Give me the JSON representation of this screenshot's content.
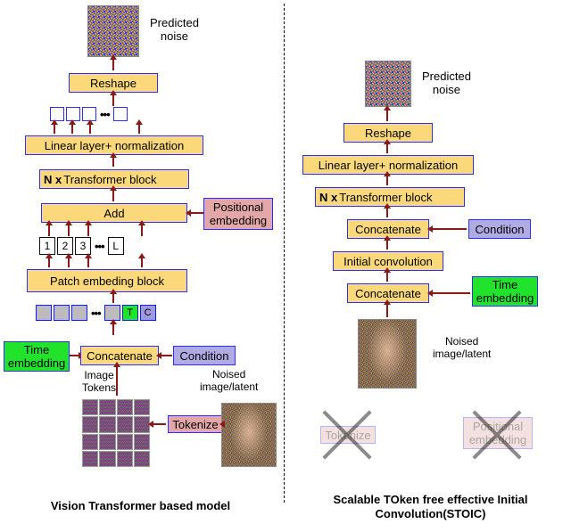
{
  "left": {
    "predicted_noise": "Predicted\nnoise",
    "reshape": "Reshape",
    "linear": "Linear layer+ normalization",
    "transformer_n": "N x ",
    "transformer": "Transformer block",
    "add": "Add",
    "pos_embed": "Positional\nembedding",
    "patch_embed": "Patch embeding block",
    "concatenate": "Concatenate",
    "time_embed": "Time\nembedding",
    "condition": "Condition",
    "image_tokens": "Image\nTokens",
    "tokenize": "Tokenize",
    "noised": "Noised\nimage/latent",
    "caption": "Vision Transformer based model",
    "num1": "1",
    "num2": "2",
    "num3": "3",
    "numL": "L",
    "tokT": "T",
    "tokC": "C"
  },
  "right": {
    "predicted_noise": "Predicted\nnoise",
    "reshape": "Reshape",
    "linear": "Linear layer+ normalization",
    "transformer_n": "N x ",
    "transformer": "Transformer block",
    "concatenate1": "Concatenate",
    "condition": "Condition",
    "initial_conv": "Initial convolution",
    "concatenate2": "Concatenate",
    "time_embed": "Time\nembedding",
    "noised": "Noised\nimage/latent",
    "tokenize": "Tokenize",
    "pos_embed": "Positional\nembedding",
    "caption": "Scalable TOken free effective Initial\nConvolution(STOIC)"
  }
}
